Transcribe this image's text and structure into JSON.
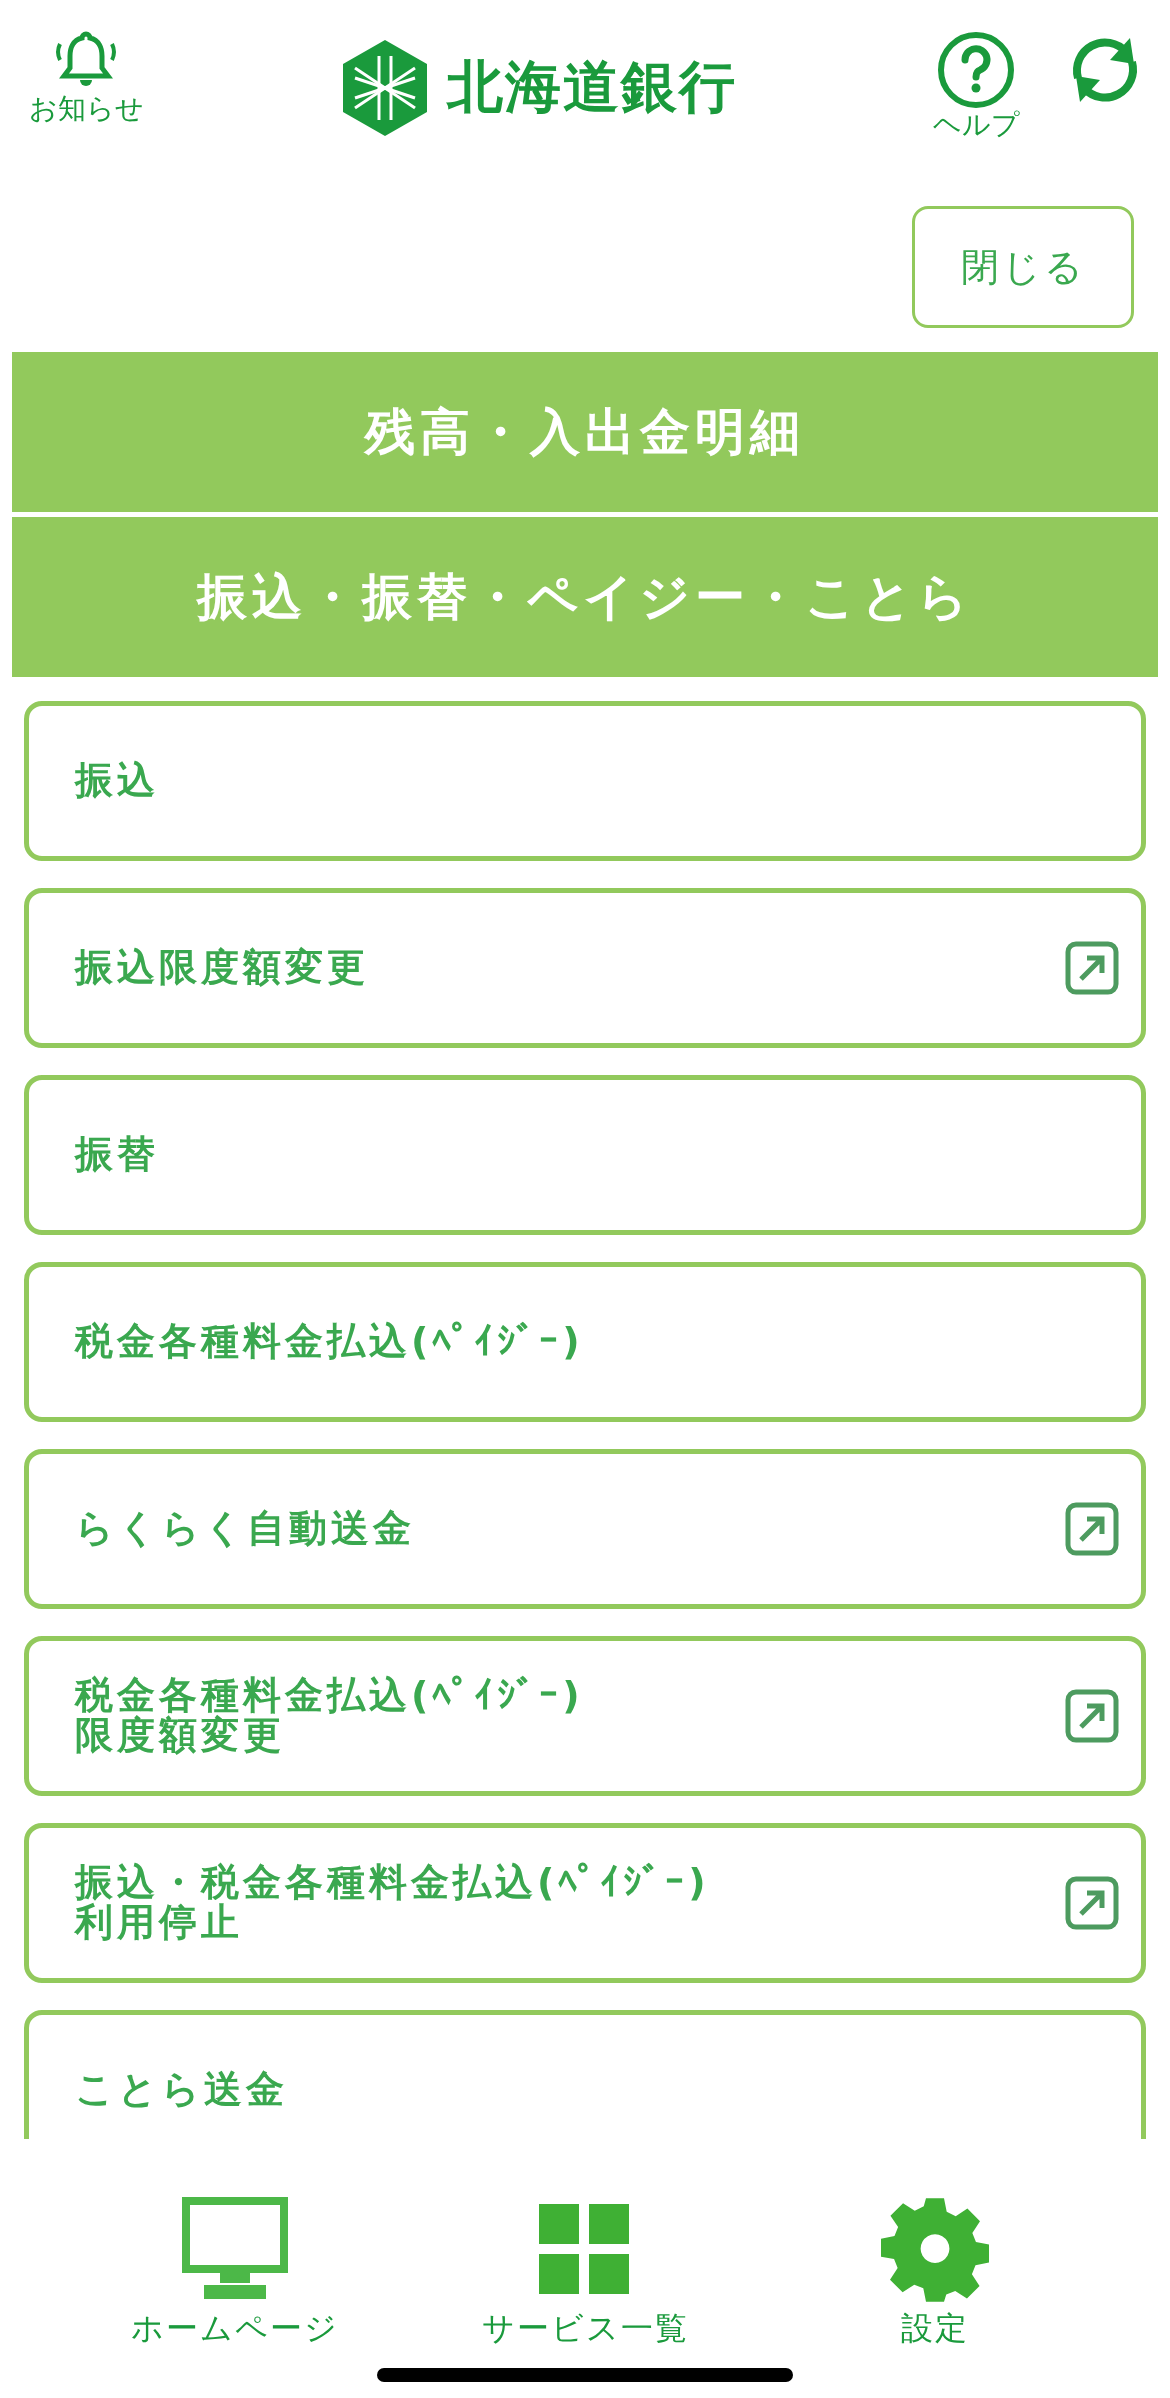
{
  "header": {
    "notifications_label": "お知らせ",
    "logo_text": "北海道銀行",
    "help_label": "ヘルプ"
  },
  "close_button": "閉じる",
  "sections": [
    {
      "title": "残高・入出金明細"
    },
    {
      "title": "振込・振替・ペイジー・ことら"
    }
  ],
  "menu_items": [
    {
      "label": "振込",
      "external": false
    },
    {
      "label": "振込限度額変更",
      "external": true
    },
    {
      "label": "振替",
      "external": false
    },
    {
      "label": "税金各種料金払込(ﾍﾟｲｼﾞｰ)",
      "external": false
    },
    {
      "label": "らくらく自動送金",
      "external": true
    },
    {
      "label": "税金各種料金払込(ﾍﾟｲｼﾞｰ)\n限度額変更",
      "external": true
    },
    {
      "label": "振込・税金各種料金払込(ﾍﾟｲｼﾞｰ)\n利用停止",
      "external": true
    },
    {
      "label": "ことら送金",
      "external": false
    }
  ],
  "bottom_nav": [
    {
      "kind": "monitor",
      "label": "ホームページ"
    },
    {
      "kind": "grid",
      "label": "サービス一覧"
    },
    {
      "kind": "gear",
      "label": "設定"
    }
  ]
}
